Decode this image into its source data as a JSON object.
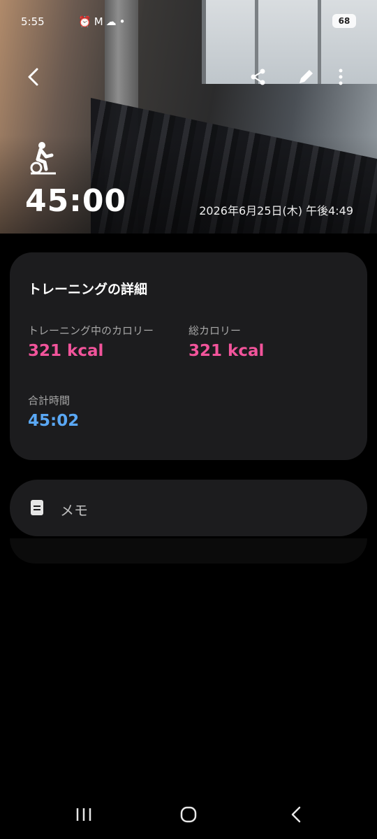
{
  "status_bar": {
    "time": "5:55",
    "notification_icons": [
      "alarm-icon",
      "gmail-icon",
      "cloud-icon",
      "dot-icon"
    ],
    "battery": "68"
  },
  "header": {
    "activity_icon": "indoor-cycling-icon",
    "duration": "45:00",
    "datetime": "2026年6月25日(木) 午後4:49"
  },
  "details": {
    "title": "トレーニングの詳細",
    "workout_calories_label": "トレーニング中のカロリー",
    "workout_calories_value": "321 kcal",
    "total_calories_label": "総カロリー",
    "total_calories_value": "321 kcal",
    "total_time_label": "合計時間",
    "total_time_value": "45:02"
  },
  "memo": {
    "label": "メモ"
  },
  "colors": {
    "pink": "#f2549b",
    "blue": "#5aa8f5",
    "card_bg": "#1c1c1e"
  }
}
